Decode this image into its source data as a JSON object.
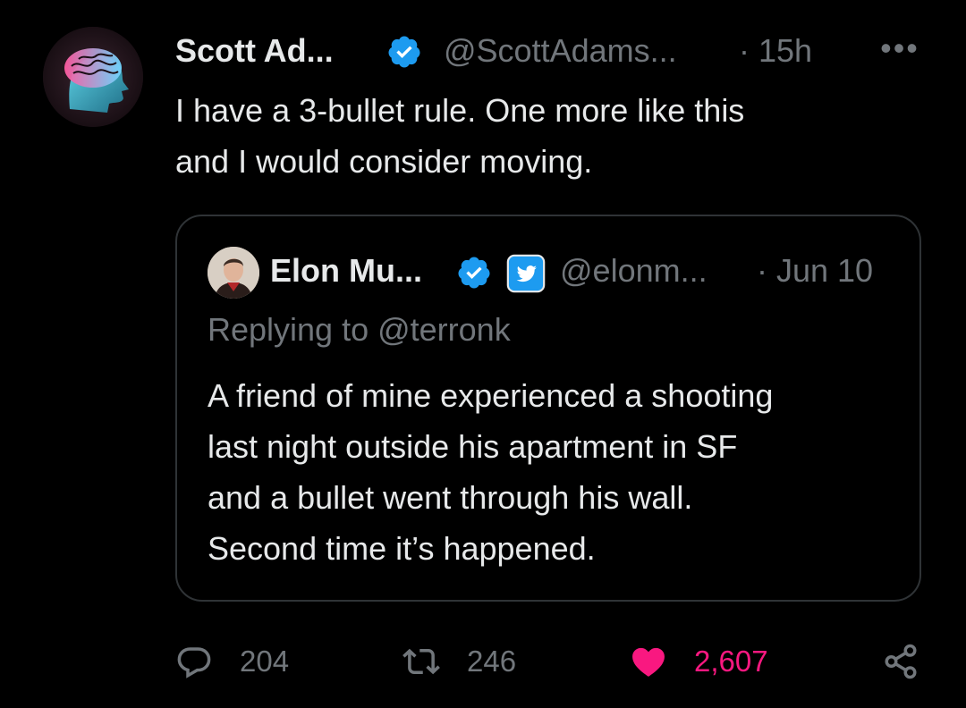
{
  "tweet": {
    "author_name": "Scott Ad...",
    "handle": "@ScottAdams...",
    "time": "· 15h",
    "more_label": "•••",
    "text": "I have a 3-bullet rule. One more like this\nand I would consider moving."
  },
  "quoted": {
    "author_name": "Elon Mu...",
    "handle": "@elonm...",
    "time": "· Jun 10",
    "replying_to": "Replying to @terronk",
    "text": "A friend of mine experienced a shooting\nlast night outside his apartment in SF\nand a bullet went through his wall.\nSecond time it’s happened."
  },
  "actions": {
    "replies": "204",
    "retweets": "246",
    "likes": "2,607"
  },
  "colors": {
    "background": "#000000",
    "text": "#e7e9ea",
    "muted": "#71767b",
    "verified": "#1d9bf0",
    "like": "#f91880",
    "border": "#2f3336"
  },
  "icons": {
    "verified": "verified-badge-icon",
    "more": "more-dots-icon",
    "reply": "reply-bubble-icon",
    "retweet": "retweet-icon",
    "like": "heart-icon",
    "share": "share-icon",
    "affiliate": "twitter-bird-badge-icon"
  }
}
